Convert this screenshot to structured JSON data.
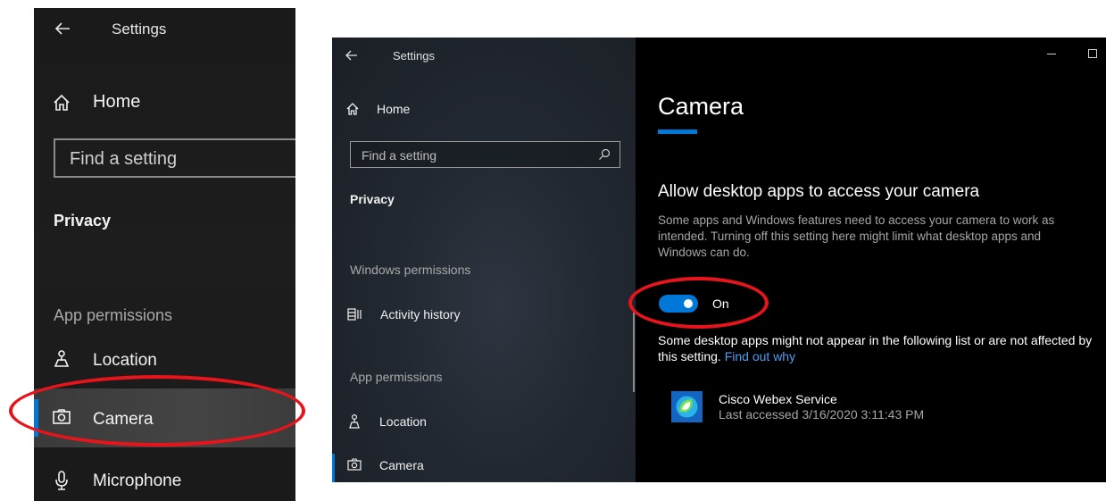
{
  "zoom_panel": {
    "title": "Settings",
    "home_label": "Home",
    "search_placeholder": "Find a setting",
    "section_label": "Privacy",
    "group_label": "App permissions",
    "items": [
      {
        "label": "Location",
        "icon": "location-icon"
      },
      {
        "label": "Camera",
        "icon": "camera-icon",
        "selected": true
      },
      {
        "label": "Microphone",
        "icon": "microphone-icon"
      }
    ]
  },
  "window": {
    "title": "Settings",
    "home_label": "Home",
    "search_placeholder": "Find a setting",
    "section_label": "Privacy",
    "windows_permissions_label": "Windows permissions",
    "activity_history_label": "Activity history",
    "app_permissions_label": "App permissions",
    "location_label": "Location",
    "camera_label": "Camera",
    "page_title": "Camera",
    "section_heading": "Allow desktop apps to access your camera",
    "description": "Some apps and Windows features need to access your camera to work as intended. Turning off this setting here might limit what desktop apps and Windows can do.",
    "toggle": {
      "state": "On",
      "on": true
    },
    "note": "Some desktop apps might not appear in the following list or are not affected by this setting.",
    "note_link": "Find out why",
    "app": {
      "name": "Cisco Webex Service",
      "last_accessed": "Last accessed 3/16/2020 3:11:43 PM"
    }
  },
  "colors": {
    "accent": "#0078d7",
    "annotation": "#e8141b",
    "link": "#4aa0f0"
  }
}
